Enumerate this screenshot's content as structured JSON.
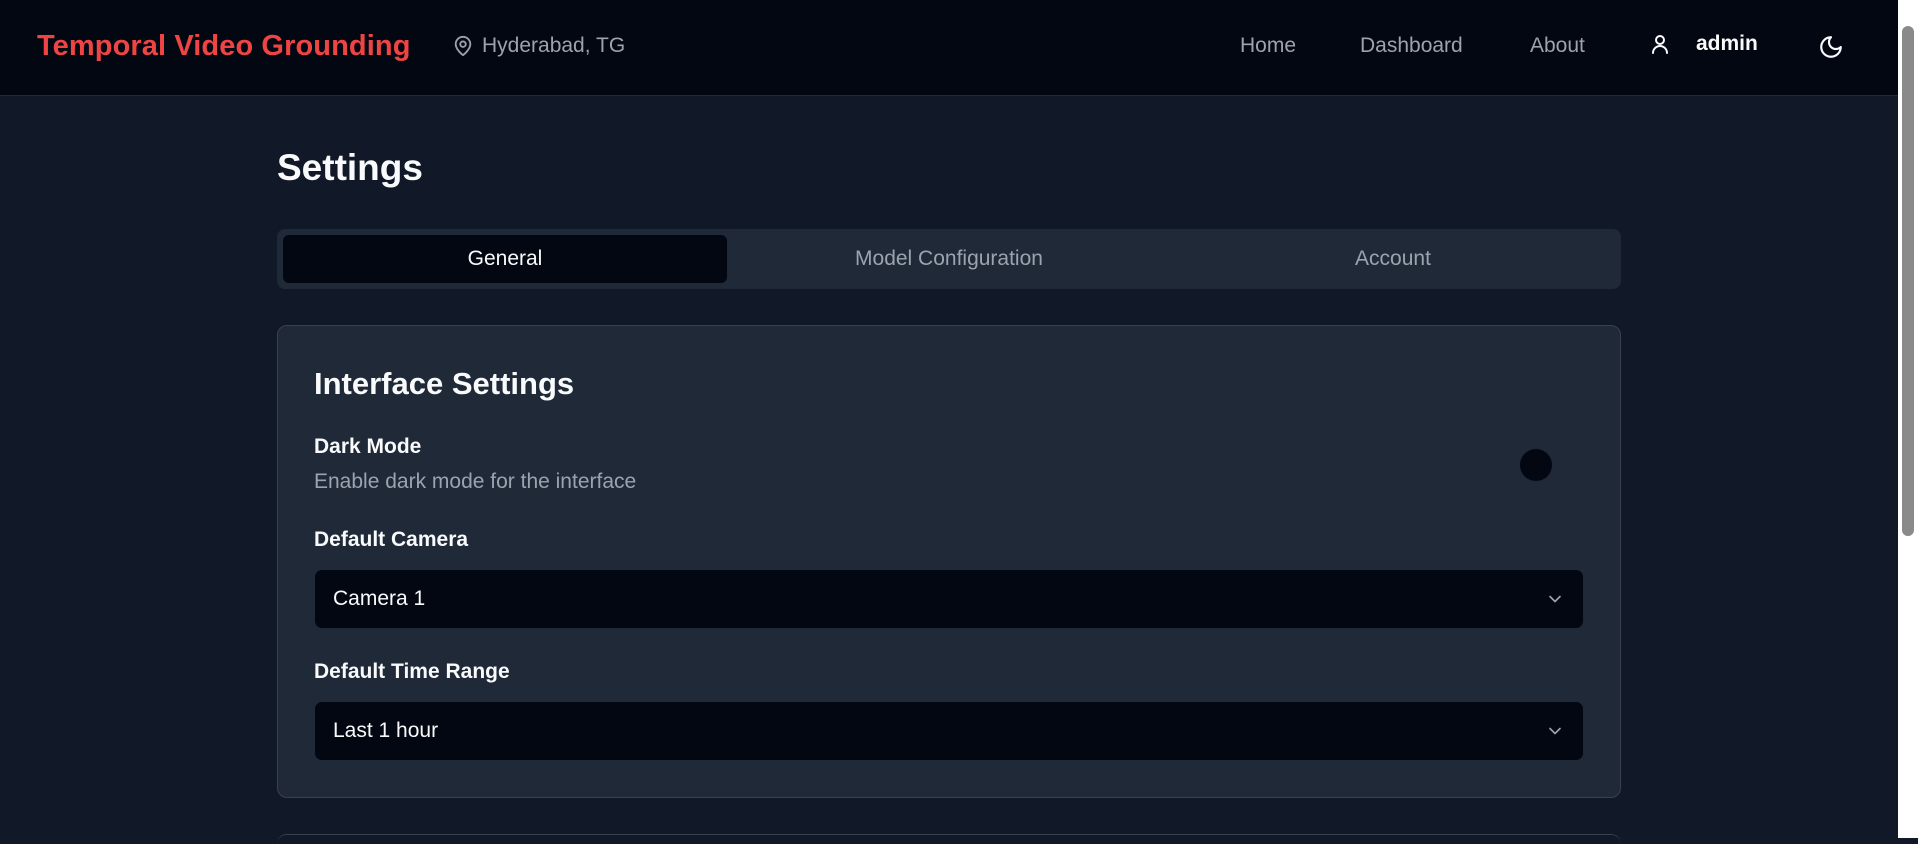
{
  "header": {
    "brand": "Temporal Video Grounding",
    "location": "Hyderabad, TG",
    "nav": {
      "home": "Home",
      "dashboard": "Dashboard",
      "about": "About"
    },
    "user": "admin",
    "icons": {
      "location": "map-pin-icon",
      "user": "user-icon",
      "theme": "moon-icon"
    }
  },
  "page": {
    "title": "Settings",
    "tabs": [
      {
        "label": "General",
        "active": true
      },
      {
        "label": "Model Configuration",
        "active": false
      },
      {
        "label": "Account",
        "active": false
      }
    ]
  },
  "interface_settings": {
    "title": "Interface Settings",
    "dark_mode": {
      "label": "Dark Mode",
      "description": "Enable dark mode for the interface",
      "enabled": false
    },
    "default_camera": {
      "label": "Default Camera",
      "value": "Camera 1"
    },
    "default_time_range": {
      "label": "Default Time Range",
      "value": "Last 1 hour"
    }
  },
  "colors": {
    "brand": "#ef4444",
    "header_bg": "#030712",
    "page_bg": "#111827",
    "card_bg": "#1f2937",
    "muted_text": "#9ca3af"
  }
}
